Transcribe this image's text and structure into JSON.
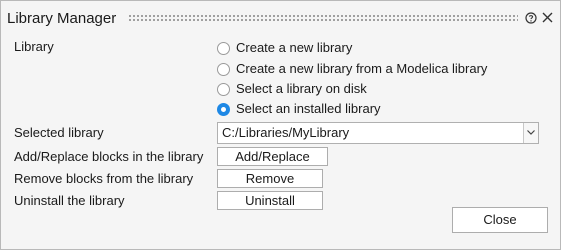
{
  "window": {
    "title": "Library Manager"
  },
  "library": {
    "label": "Library",
    "options": [
      {
        "label": "Create a new library",
        "checked": false
      },
      {
        "label": "Create a new library from a Modelica library",
        "checked": false
      },
      {
        "label": "Select a library on disk",
        "checked": false
      },
      {
        "label": "Select an installed library",
        "checked": true
      }
    ]
  },
  "selected_library": {
    "label": "Selected library",
    "value": "C:/Libraries/MyLibrary"
  },
  "actions": {
    "add_replace_label": "Add/Replace blocks in the library",
    "add_replace_button": "Add/Replace",
    "remove_label": "Remove blocks from the library",
    "remove_button": "Remove",
    "uninstall_label": "Uninstall the library",
    "uninstall_button": "Uninstall"
  },
  "footer": {
    "close_button": "Close"
  },
  "colors": {
    "accent": "#1e88e5",
    "window_bg": "#f5f5f5"
  }
}
